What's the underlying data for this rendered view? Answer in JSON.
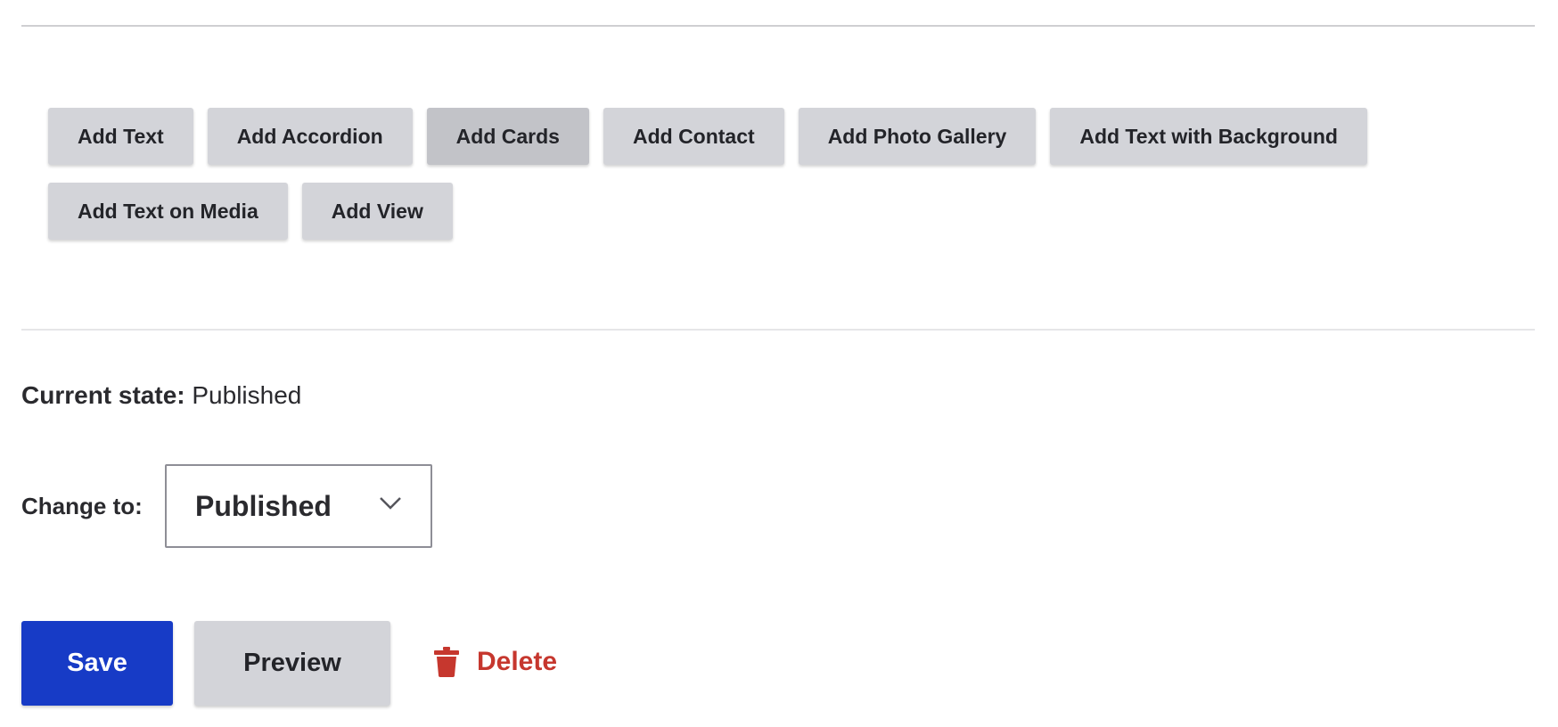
{
  "add_buttons": {
    "row1": [
      "Add Text",
      "Add Accordion",
      "Add Cards",
      "Add Contact",
      "Add Photo Gallery",
      "Add Text with Background"
    ],
    "row2": [
      "Add Text on Media",
      "Add View"
    ]
  },
  "moderation": {
    "current_state_label": "Current state:",
    "current_state_value": "Published",
    "change_to_label": "Change to:",
    "change_to_selected": "Published"
  },
  "actions": {
    "save": "Save",
    "preview": "Preview",
    "delete": "Delete"
  },
  "colors": {
    "primary": "#173bc6",
    "danger": "#c6372e",
    "button_gray": "#d3d4d9"
  },
  "icons": {
    "delete": "trash-icon",
    "select": "chevron-down-icon"
  }
}
